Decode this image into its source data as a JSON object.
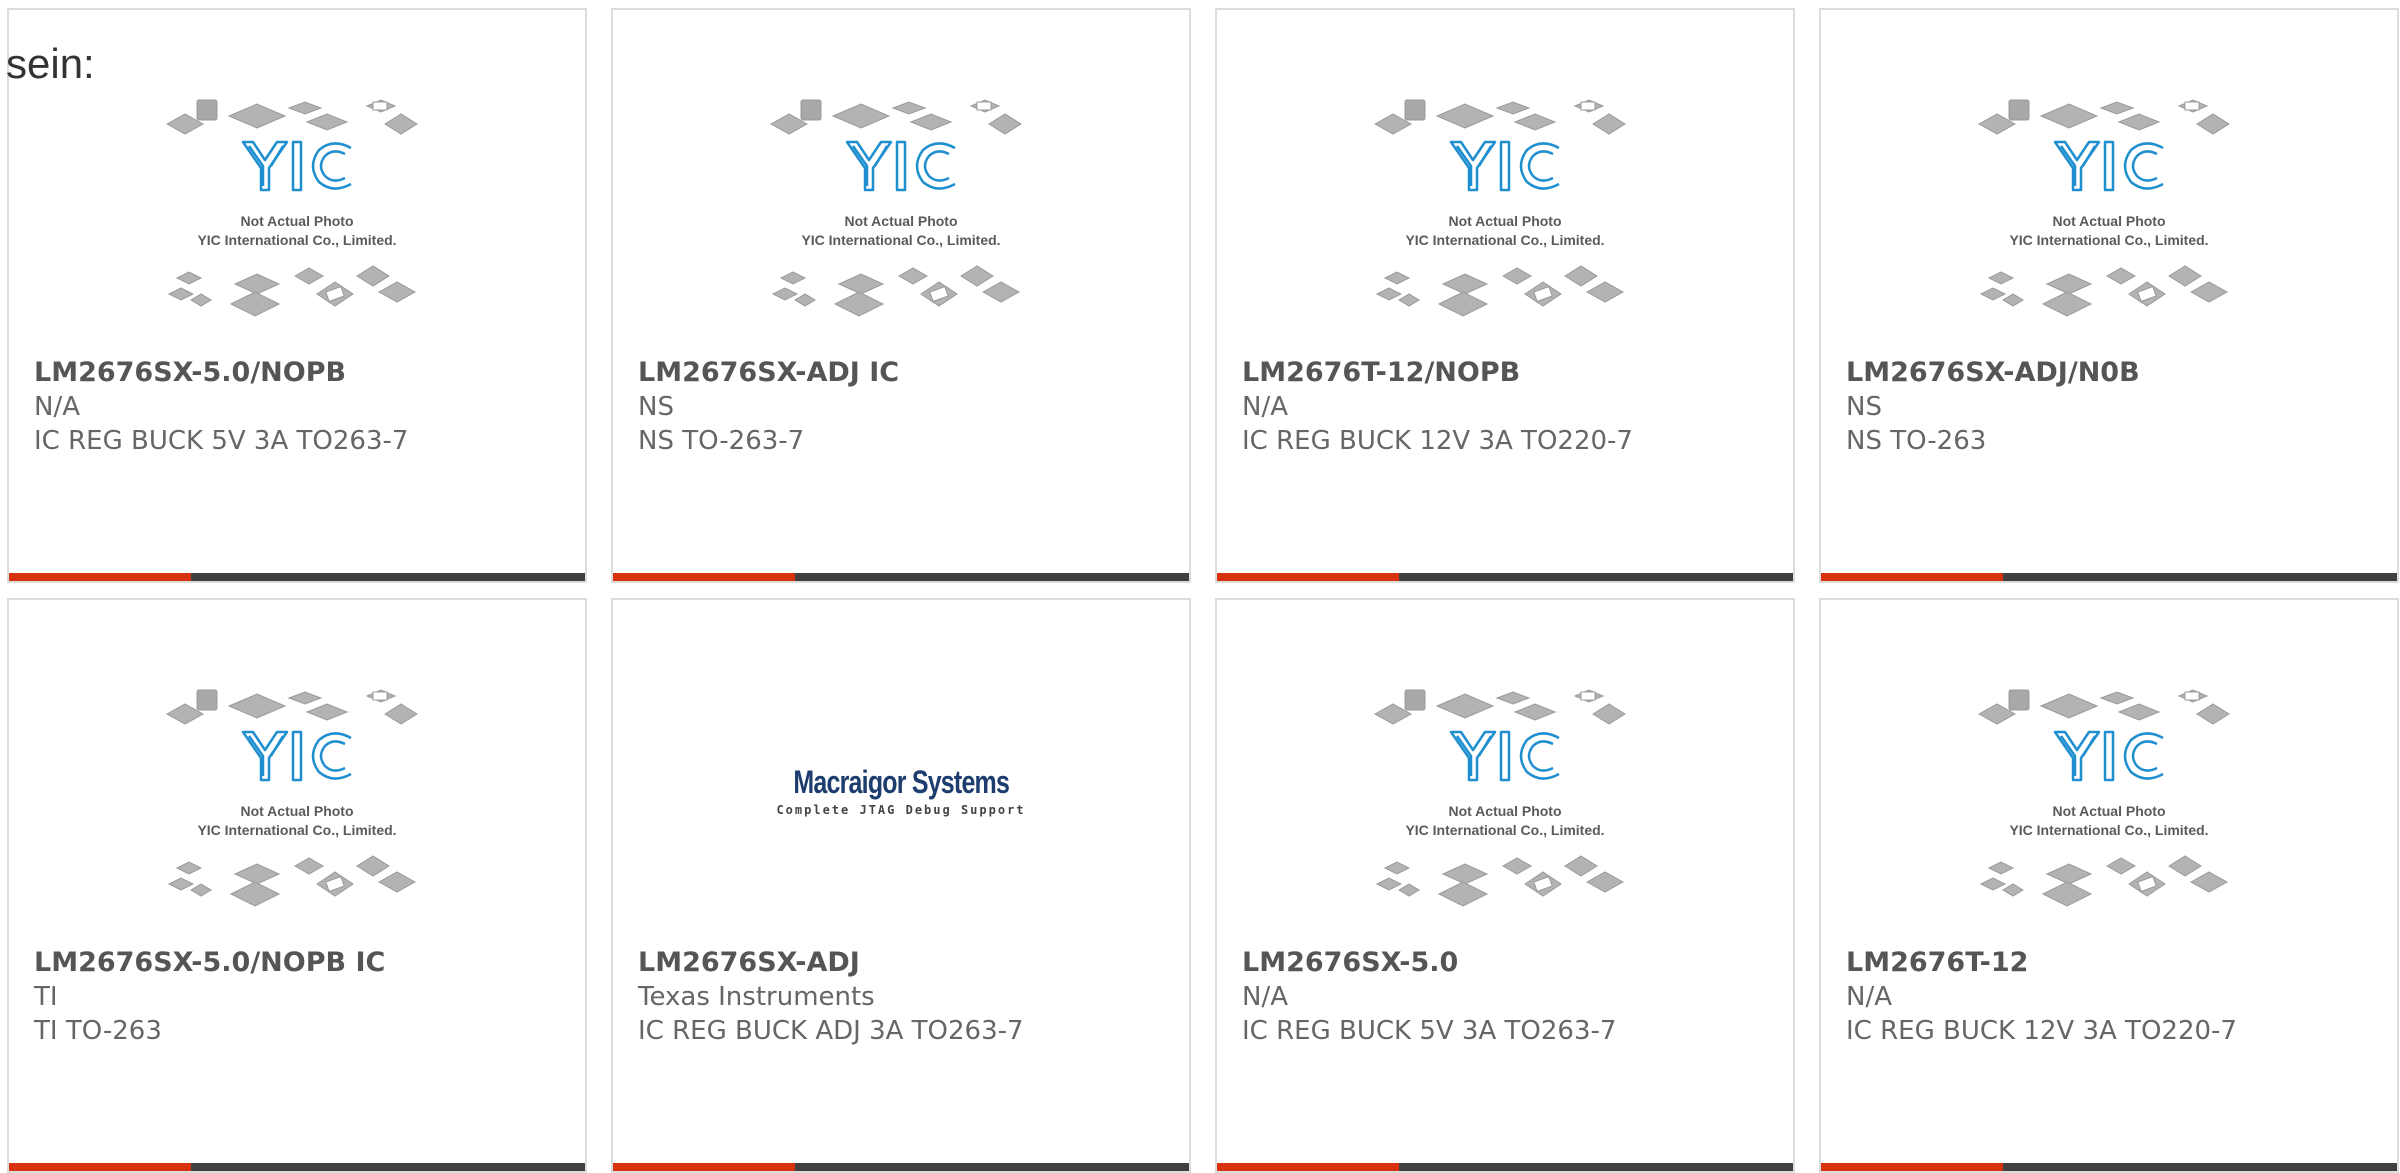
{
  "lead_text": "sein:",
  "placeholder_image": {
    "line1": "Not Actual Photo",
    "line2": "YIC International Co., Limited.",
    "logo_text": "YIC"
  },
  "macraigor_logo": {
    "title": "Macraigor Systems",
    "subtitle": "Complete JTAG Debug Support"
  },
  "colors": {
    "accent": "#d7330e",
    "bar": "#404040",
    "logo_blue": "#1f8fcf"
  },
  "products": [
    {
      "part": "LM2676SX-5.0/NOPB",
      "manufacturer": "N/A",
      "description": "IC REG BUCK 5V 3A TO263-7",
      "image": "yic-placeholder"
    },
    {
      "part": "LM2676SX-ADJ IC",
      "manufacturer": "NS",
      "description": "NS TO-263-7",
      "image": "yic-placeholder"
    },
    {
      "part": "LM2676T-12/NOPB",
      "manufacturer": "N/A",
      "description": "IC REG BUCK 12V 3A TO220-7",
      "image": "yic-placeholder"
    },
    {
      "part": "LM2676SX-ADJ/N0B",
      "manufacturer": "NS",
      "description": "NS TO-263",
      "image": "yic-placeholder"
    },
    {
      "part": "LM2676SX-5.0/NOPB IC",
      "manufacturer": "TI",
      "description": "TI TO-263",
      "image": "yic-placeholder"
    },
    {
      "part": "LM2676SX-ADJ",
      "manufacturer": "Texas Instruments",
      "description": "IC REG BUCK ADJ 3A TO263-7",
      "image": "macraigor-logo"
    },
    {
      "part": "LM2676SX-5.0",
      "manufacturer": "N/A",
      "description": "IC REG BUCK 5V 3A TO263-7",
      "image": "yic-placeholder"
    },
    {
      "part": "LM2676T-12",
      "manufacturer": "N/A",
      "description": "IC REG BUCK 12V 3A TO220-7",
      "image": "yic-placeholder"
    }
  ]
}
